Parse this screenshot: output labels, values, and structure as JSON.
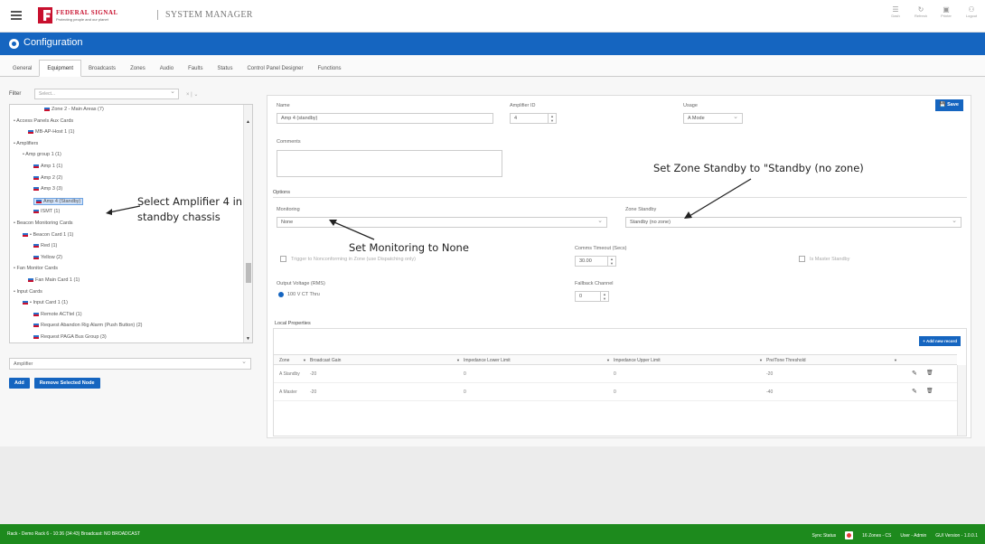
{
  "header": {
    "brand_name": "FEDERAL SIGNAL",
    "brand_tagline": "Protecting people and our planet",
    "app_title": "SYSTEM MANAGER",
    "icons": [
      {
        "name": "table-icon",
        "glyph": "☰",
        "label": "Dash"
      },
      {
        "name": "refresh-icon",
        "glyph": "↻",
        "label": "Refresh"
      },
      {
        "name": "print-icon",
        "glyph": "▣",
        "label": "Printer"
      },
      {
        "name": "user-icon",
        "glyph": "⚇",
        "label": "Logout"
      }
    ]
  },
  "config_bar": {
    "title": "Configuration"
  },
  "tabs": [
    "General",
    "Equipment",
    "Broadcasts",
    "Zones",
    "Audio",
    "Faults",
    "Status",
    "Control Panel Designer",
    "Functions"
  ],
  "active_tab": "Equipment",
  "left_pane": {
    "filter_label": "Filter",
    "filter_placeholder": "Select...",
    "filter_clear": "× | ⌄",
    "tree": [
      {
        "label": "Zone 2 - Main Areas (7)",
        "indent": 38,
        "flag": true
      },
      {
        "label": "• Access Panels Aux Cards",
        "indent": 4,
        "flag": false
      },
      {
        "label": "MB-AP-Host 1 (1)",
        "indent": 20,
        "flag": true
      },
      {
        "label": "• Amplifiers",
        "indent": 4,
        "flag": false
      },
      {
        "label": "• Amp group 1 (1)",
        "indent": 14,
        "flag": false
      },
      {
        "label": "Amp 1 (1)",
        "indent": 26,
        "flag": true
      },
      {
        "label": "Amp 2 (2)",
        "indent": 26,
        "flag": true
      },
      {
        "label": "Amp 3 (3)",
        "indent": 26,
        "flag": true
      },
      {
        "label": "Amp 4 (Standby)",
        "indent": 26,
        "flag": true,
        "selected": true
      },
      {
        "label": "ISMT (1)",
        "indent": 26,
        "flag": true
      },
      {
        "label": "• Beacon Monitoring Cards",
        "indent": 4,
        "flag": false
      },
      {
        "label": "• Beacon Card 1 (1)",
        "indent": 14,
        "flag": true
      },
      {
        "label": "Red (1)",
        "indent": 26,
        "flag": true
      },
      {
        "label": "Yellow (2)",
        "indent": 26,
        "flag": true
      },
      {
        "label": "• Fan Monitor Cards",
        "indent": 4,
        "flag": false
      },
      {
        "label": "Fan Main Card 1 (1)",
        "indent": 20,
        "flag": true
      },
      {
        "label": "• Input Cards",
        "indent": 4,
        "flag": false
      },
      {
        "label": "• Input Card 1 (1)",
        "indent": 14,
        "flag": true
      },
      {
        "label": "Remote ACTtel (1)",
        "indent": 26,
        "flag": true
      },
      {
        "label": "Request Abandon Rig Alarm (Push Button) (2)",
        "indent": 26,
        "flag": true
      },
      {
        "label": "Request PAGA Bus Group (3)",
        "indent": 26,
        "flag": true
      }
    ],
    "type_select": "Amplifier",
    "add_label": "Add",
    "remove_label": "Remove Selected Node"
  },
  "form": {
    "name_label": "Name",
    "name_value": "Amp 4 (standby)",
    "amp_id_label": "Amplifier ID",
    "amp_id_value": "4",
    "usage_label": "Usage",
    "usage_value": "A Mode",
    "save_label": "Save",
    "comments_label": "Comments",
    "options_label": "Options",
    "monitoring_label": "Monitoring",
    "monitoring_value": "None",
    "zone_standby_label": "Zone Standby",
    "zone_standby_value": "Standby (no zone)",
    "ttm_label": "Trigger to Nonconforming in Zone (use Dispatching only)",
    "comms_timeout_label": "Comms Timeout (Secs)",
    "comms_timeout_value": "30.00",
    "is_master_label": "Is Master Standby",
    "output_voltage_label": "Output Voltage (RMS)",
    "output_voltage_value": "100 V CT Thru",
    "fallback_label": "Fallback Channel",
    "fallback_value": "0"
  },
  "local_props": {
    "title": "Local Properties",
    "add_record": "+ Add new record",
    "columns": [
      "Zone",
      "Broadcast Gain",
      "Impedance Lower Limit",
      "Impedance Upper Limit",
      "Pre/Tone Threshold"
    ],
    "rows": [
      [
        "A Standby",
        "-20",
        "0",
        "0",
        "-20"
      ],
      [
        "A Master",
        "-20",
        "0",
        "0",
        "-40"
      ]
    ]
  },
  "annotations": {
    "select_amp": "Select Amplifier 4 in\nstandby chassis",
    "set_zone": "Set Zone Standby to \"Standby (no zone)",
    "set_monitoring": "Set Monitoring to None"
  },
  "status_bar": {
    "left": "Rack - Demo Rack 6 - 10:36 (34:43)   Broadcast:  NO BROADCAST",
    "sync_label": "Sync Status",
    "zone": "16 Zones - CS",
    "user": "User - Admin",
    "version": "GUI Version - 1.0.0.1"
  }
}
